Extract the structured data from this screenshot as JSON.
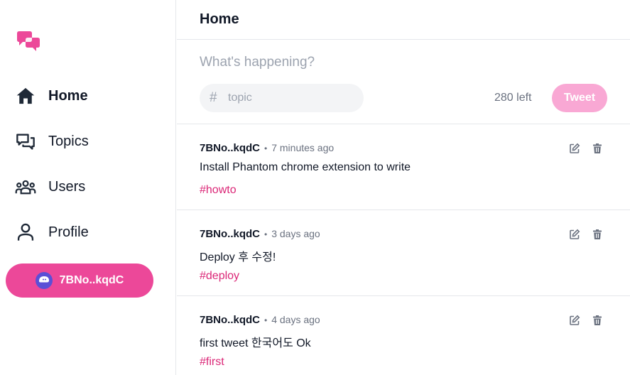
{
  "sidebar": {
    "items": [
      {
        "label": "Home",
        "icon": "home-icon",
        "active": true
      },
      {
        "label": "Topics",
        "icon": "chat-bubbles-icon",
        "active": false
      },
      {
        "label": "Users",
        "icon": "users-icon",
        "active": false
      },
      {
        "label": "Profile",
        "icon": "user-icon",
        "active": false
      }
    ],
    "wallet": {
      "label": "7BNo..kqdC",
      "icon": "phantom-ghost-icon"
    }
  },
  "header": {
    "title": "Home"
  },
  "composer": {
    "placeholder": "What's happening?",
    "topic_prefix": "#",
    "topic_placeholder": "topic",
    "chars_left": "280 left",
    "tweet_label": "Tweet"
  },
  "tweets": [
    {
      "author": "7BNo..kqdC",
      "separator": "•",
      "time": "7 minutes ago",
      "content": "Install Phantom chrome extension to write",
      "topic": "#howto"
    },
    {
      "author": "7BNo..kqdC",
      "separator": "•",
      "time": "3 days ago",
      "content": "Deploy 후 수정!",
      "topic": "#deploy"
    },
    {
      "author": "7BNo..kqdC",
      "separator": "•",
      "time": "4 days ago",
      "content": "first tweet 한국어도 Ok",
      "topic": "#first"
    }
  ],
  "colors": {
    "accent": "#ec4899",
    "accent_light": "#f9a8d4",
    "topic": "#db2777",
    "text": "#111827",
    "muted": "#6b7280"
  }
}
